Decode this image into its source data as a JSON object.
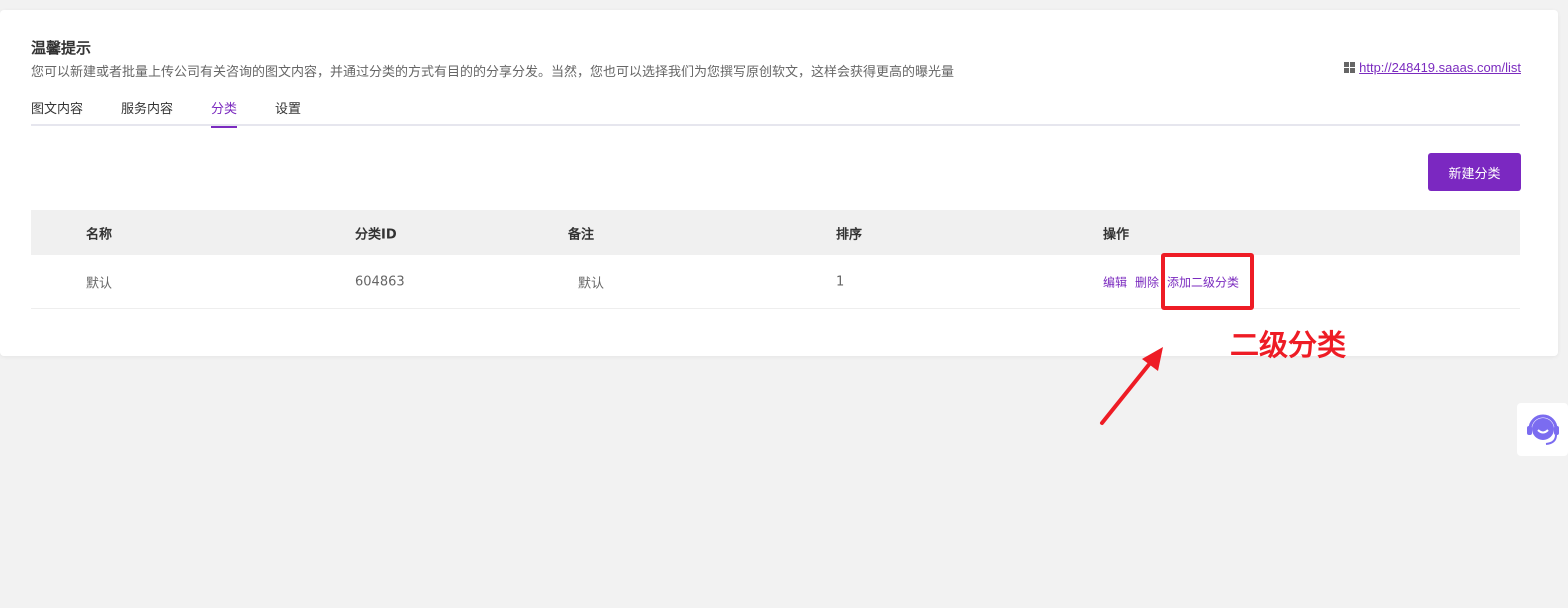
{
  "tip": {
    "title": "温馨提示",
    "description": "您可以新建或者批量上传公司有关咨询的图文内容，并通过分类的方式有目的的分享分发。当然，您也可以选择我们为您撰写原创软文，这样会获得更高的曝光量",
    "link": "http://248419.saaas.com/list"
  },
  "tabs": [
    "图文内容",
    "服务内容",
    "分类",
    "设置"
  ],
  "active_tab": "分类",
  "new_button": "新建分类",
  "table": {
    "headers": [
      "名称",
      "分类ID",
      "备注",
      "排序",
      "操作"
    ],
    "rows": [
      {
        "name": "默认",
        "id": "604863",
        "note": "默认",
        "order": "1",
        "actions": [
          "编辑",
          "删除",
          "添加二级分类"
        ]
      }
    ]
  },
  "annotation": "二级分类",
  "colors": {
    "accent": "#7b28c1",
    "annotation": "#ee1c25"
  }
}
